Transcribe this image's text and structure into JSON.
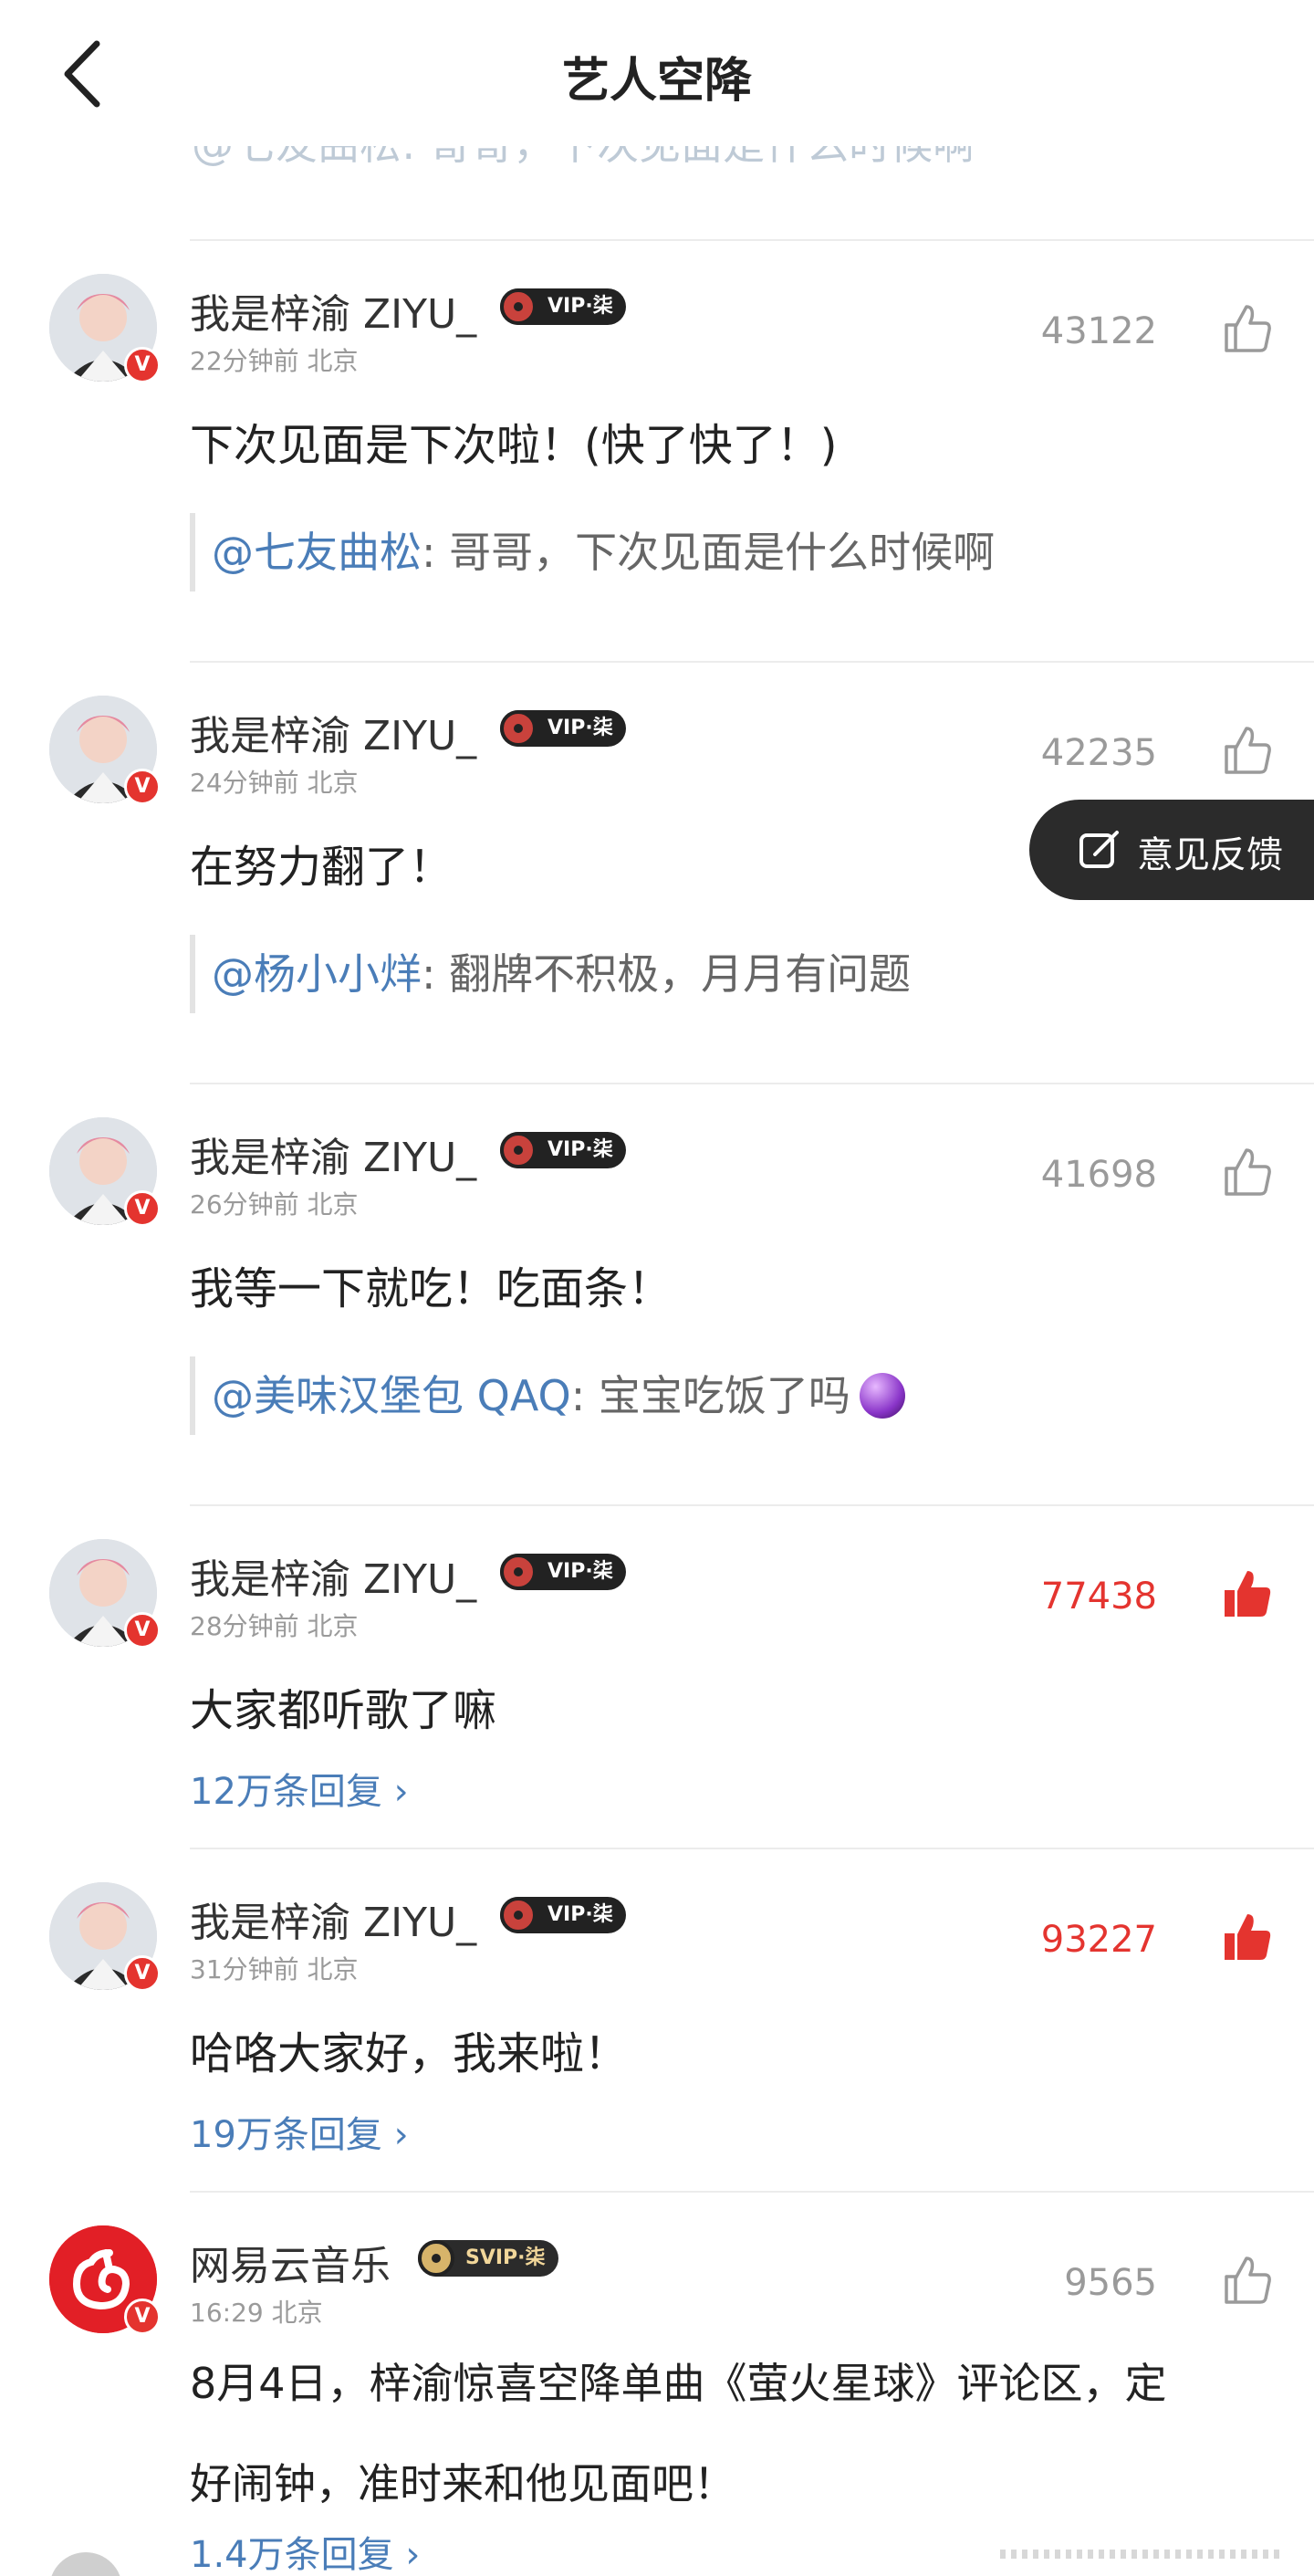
{
  "header": {
    "title": "艺人空降"
  },
  "cut_off_line": "@七友曲松: 哥哥，下次见面是什么时候啊",
  "feedback": {
    "label": "意见反馈"
  },
  "comments": [
    {
      "username": "我是梓渝 ZIYU_",
      "badge": "VIP·柒",
      "time": "22分钟前",
      "location": "北京",
      "likes": "43122",
      "liked": false,
      "content": "下次见面是下次啦！(快了快了！)",
      "quote_at": "@七友曲松",
      "quote_text": ": 哥哥，下次见面是什么时候啊",
      "reply_count": ""
    },
    {
      "username": "我是梓渝 ZIYU_",
      "badge": "VIP·柒",
      "time": "24分钟前",
      "location": "北京",
      "likes": "42235",
      "liked": false,
      "content": "在努力翻了！",
      "quote_at": "@杨小小烊",
      "quote_text": ": 翻牌不积极，月月有问题",
      "reply_count": ""
    },
    {
      "username": "我是梓渝 ZIYU_",
      "badge": "VIP·柒",
      "time": "26分钟前",
      "location": "北京",
      "likes": "41698",
      "liked": false,
      "content": "我等一下就吃！吃面条！",
      "quote_at": "@美味汉堡包 QAQ",
      "quote_text": ": 宝宝吃饭了吗",
      "reply_count": ""
    },
    {
      "username": "我是梓渝 ZIYU_",
      "badge": "VIP·柒",
      "time": "28分钟前",
      "location": "北京",
      "likes": "77438",
      "liked": true,
      "content": "大家都听歌了嘛",
      "reply_count": "12万条回复"
    },
    {
      "username": "我是梓渝 ZIYU_",
      "badge": "VIP·柒",
      "time": "31分钟前",
      "location": "北京",
      "likes": "93227",
      "liked": true,
      "content": "哈咯大家好，我来啦！",
      "reply_count": "19万条回复"
    },
    {
      "username": "网易云音乐",
      "badge": "SVIP·柒",
      "time": "16:29",
      "location": "北京",
      "likes": "9565",
      "liked": false,
      "content_line1": "8月4日，梓渝惊喜空降单曲《萤火星球》评论区，定",
      "content_line2": "好闹钟，准时来和他见面吧！",
      "reply_count": "1.4万条回复"
    }
  ],
  "colors": {
    "accent_red": "#e4342f",
    "link_blue": "#4a7db8",
    "muted_gray": "#9a9a9a"
  }
}
